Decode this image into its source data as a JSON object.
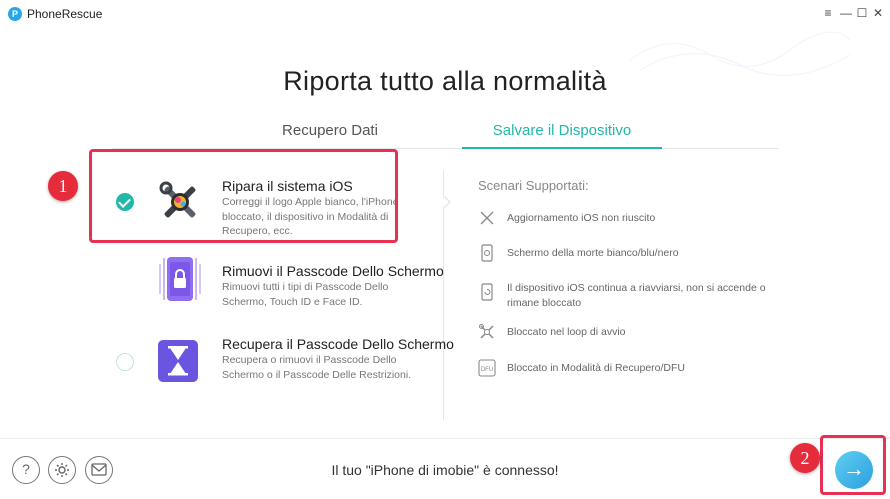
{
  "app": {
    "name": "PhoneRescue",
    "logo_letter": "P"
  },
  "window": {
    "menu_icon": "≡",
    "minimize_icon": "—",
    "maximize_icon": "☐",
    "close_icon": "✕"
  },
  "main": {
    "title": "Riporta tutto alla normalità"
  },
  "tabs": [
    {
      "label": "Recupero Dati",
      "active": false
    },
    {
      "label": "Salvare il Dispositivo",
      "active": true
    }
  ],
  "options": [
    {
      "title": "Ripara il sistema iOS",
      "description": "Correggi il logo Apple bianco, l'iPhone bloccato, il dispositivo in Modalità di Recupero, ecc.",
      "selected": true,
      "icon": "repair-tools-icon"
    },
    {
      "title": "Rimuovi il Passcode Dello Schermo",
      "description": "Rimuovi tutti i tipi di Passcode Dello Schermo, Touch ID e Face ID.",
      "selected": false,
      "icon": "phone-lock-icon"
    },
    {
      "title": "Recupera il Passcode Dello Schermo",
      "description": "Recupera o rimuovi il Passcode Dello Schermo o il Passcode Delle Restrizioni.",
      "selected": false,
      "icon": "hourglass-icon"
    }
  ],
  "scenarios": {
    "title": "Scenari Supportati:",
    "items": [
      {
        "text": "Aggiornamento iOS non riuscito",
        "icon": "cross-icon"
      },
      {
        "text": "Schermo della morte bianco/blu/nero",
        "icon": "phone-screen-icon"
      },
      {
        "text": "Il dispositivo iOS continua a riavviarsi, non si accende o rimane bloccato",
        "icon": "phone-restart-icon"
      },
      {
        "text": "Bloccato nel loop di avvio",
        "icon": "tools-icon"
      },
      {
        "text": "Bloccato in Modalità di Recupero/DFU",
        "icon": "dfu-icon"
      }
    ],
    "dfu_label": "DFU"
  },
  "annotations": {
    "badge1": "1",
    "badge2": "2"
  },
  "footer": {
    "help_icon": "?",
    "status": "Il tuo \"iPhone di imobie\" è connesso!",
    "next_icon": "→"
  },
  "colors": {
    "accent": "#20b8a8",
    "highlight": "#e63152",
    "next_button": "#2b9fe0"
  }
}
